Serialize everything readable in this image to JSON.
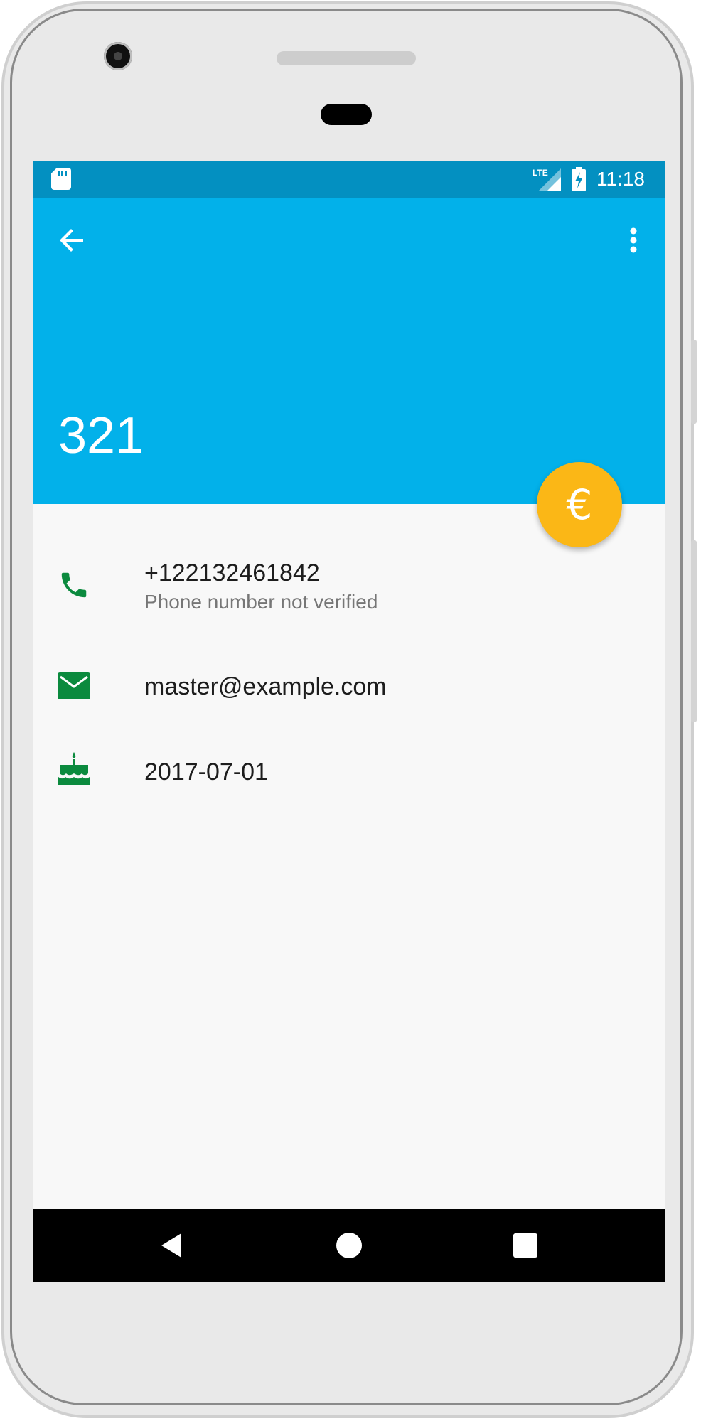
{
  "status_bar": {
    "time": "11:18",
    "network_label": "LTE",
    "icons": [
      "sd-card-icon",
      "lte-signal-icon",
      "battery-charging-icon"
    ]
  },
  "header": {
    "name": "321",
    "icons": [
      "arrow-left-icon",
      "more-vert-icon"
    ]
  },
  "fab": {
    "symbol": "€",
    "icon": "euro-icon"
  },
  "details": [
    {
      "icon": "phone-icon",
      "primary": "+122132461842",
      "secondary": "Phone number not verified"
    },
    {
      "icon": "email-icon",
      "primary": "master@example.com"
    },
    {
      "icon": "cake-icon",
      "primary": "2017-07-01"
    }
  ],
  "nav_bar": {
    "icons": [
      "back-triangle-icon",
      "home-circle-icon",
      "recents-square-icon"
    ]
  },
  "colors": {
    "status_bar": "#0390c1",
    "header": "#02b1ea",
    "fab": "#fbb716",
    "detail_icon": "#0b8a3e",
    "content_bg": "#f8f8f8",
    "nav_bar": "#000000"
  }
}
